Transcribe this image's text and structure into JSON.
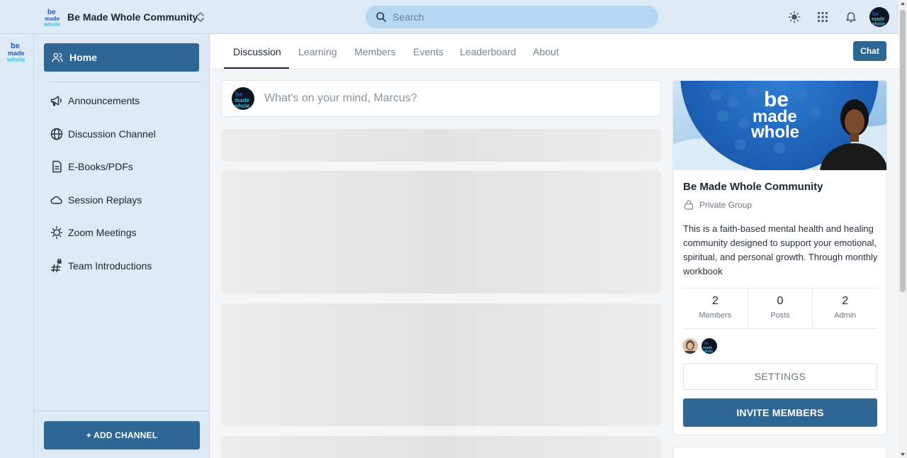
{
  "app": {
    "community_name": "Be Made Whole Community",
    "search_placeholder": "Search"
  },
  "logo_text": {
    "line1": "be",
    "line2": "made",
    "line3": "whole"
  },
  "sidebar": {
    "home_label": "Home",
    "items": [
      {
        "label": "Announcements",
        "icon": "megaphone-icon"
      },
      {
        "label": "Discussion Channel",
        "icon": "globe-icon"
      },
      {
        "label": "E-Books/PDFs",
        "icon": "document-icon"
      },
      {
        "label": "Session Replays",
        "icon": "cloud-icon"
      },
      {
        "label": "Zoom Meetings",
        "icon": "lightbulb-icon"
      },
      {
        "label": "Team Introductions",
        "icon": "hash-lock-icon"
      }
    ],
    "add_channel_label": "+ ADD CHANNEL"
  },
  "tabs": {
    "items": [
      "Discussion",
      "Learning",
      "Members",
      "Events",
      "Leaderboard",
      "About"
    ],
    "active": "Discussion",
    "chat_label": "Chat"
  },
  "composer": {
    "placeholder": "What's on your mind, Marcus?"
  },
  "group_card": {
    "title": "Be Made Whole Community",
    "privacy": "Private Group",
    "description": "This is a faith-based mental health and healing community designed to support your emotional, spiritual, and personal growth. Through monthly workbook",
    "stats": [
      {
        "value": "2",
        "label": "Members"
      },
      {
        "value": "0",
        "label": "Posts"
      },
      {
        "value": "2",
        "label": "Admin"
      }
    ],
    "settings_label": "SETTINGS",
    "invite_label": "INVITE MEMBERS"
  },
  "colors": {
    "brand": "#2e6694",
    "sidebar_bg": "#dde9f5",
    "search_bg": "#b6d5f1",
    "logo_blue": "#1f5fb8",
    "logo_cyan": "#3fc0e6"
  }
}
